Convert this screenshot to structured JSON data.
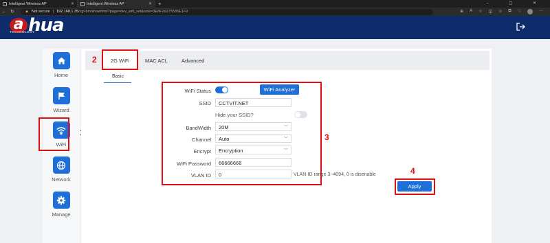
{
  "browser": {
    "tabs": [
      {
        "title": "Intelligent Wireless AP"
      },
      {
        "title": "Intelligent Wireless AP"
      }
    ],
    "new_tab": "+",
    "not_secure": "Not secure",
    "url_host": "192.168.1.35",
    "url_path": "/cgi-bin/showhtml?page=dev_wifi_set&stok=3E8F26275585E1F9",
    "window_controls": "–  ◻  ✕"
  },
  "header": {
    "logo_mark": "a",
    "logo_text": "hua",
    "logo_sub": "TECHNOLOGY"
  },
  "sidebar": {
    "items": [
      {
        "label": "Home",
        "icon": "home-icon"
      },
      {
        "label": "Wizard",
        "icon": "flag-icon"
      },
      {
        "label": "WiFi",
        "icon": "wifi-icon"
      },
      {
        "label": "Network",
        "icon": "globe-icon"
      },
      {
        "label": "Manage",
        "icon": "gear-icon"
      }
    ]
  },
  "tabs": {
    "items": [
      {
        "label": "2G WiFi"
      },
      {
        "label": "MAC ACL"
      },
      {
        "label": "Advanced"
      }
    ],
    "subtab": "Basic"
  },
  "form": {
    "wifi_status_label": "WiFi Status",
    "analyzer_button": "WiFi Analyzer",
    "ssid_label": "SSID",
    "ssid_value": "CCTVIT.NET",
    "hide_ssid_label": "Hide your SSID?",
    "bandwidth_label": "BandWidth",
    "bandwidth_value": "20M",
    "channel_label": "Channel",
    "channel_value": "Auto",
    "encrypt_label": "Encrypt",
    "encrypt_value": "Encryption",
    "password_label": "WiFi Password",
    "password_value": "66666666",
    "vlan_label": "VLAN ID",
    "vlan_value": "0",
    "vlan_note": "VLAN-ID range 3~4094, 0 is disenable"
  },
  "apply_label": "Apply",
  "annotations": {
    "m1": "1",
    "m2": "2",
    "m3": "3",
    "m4": "4"
  },
  "colors": {
    "accent": "#1e6fd8",
    "header": "#0e2b6b",
    "highlight": "#e01010"
  }
}
